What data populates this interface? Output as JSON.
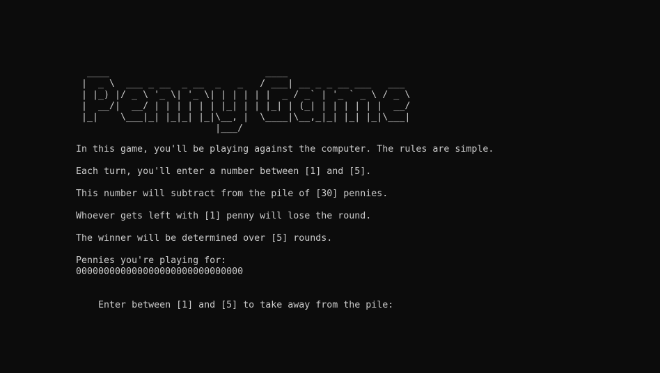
{
  "banner": {
    "ascii_art": "  ____                            ____\n |  _ \\  ___ _ __  _ __  _   _   / ___| __ _ _ __ ___   ___\n | |_) |/ _ \\ '_ \\| '_ \\| | | | | |  _ / _` | '_ ` _ \\ / _ \\\n |  __/|  __/ | | | | | | |_| | | |_| | (_| | | | | | |  __/\n |_|    \\___|_| |_|_| |_|\\__, |  \\____|\\__,_|_| |_| |_|\\___|\n                         |___/",
    "text": "Penny Game"
  },
  "console": {
    "intro": "In this game, you'll be playing against the computer. The rules are simple.",
    "rule_turn": "Each turn, you'll enter a number between [1] and [5].",
    "rule_subtract": "This number will subtract from the pile of [30] pennies.",
    "rule_lose": "Whoever gets left with [1] penny will lose the round.",
    "rule_rounds": "The winner will be determined over [5] rounds.",
    "pennies_label": "Pennies you're playing for:",
    "pennies_pile": "000000000000000000000000000000",
    "prompt": "Enter between [1] and [5] to take away from the pile:"
  }
}
